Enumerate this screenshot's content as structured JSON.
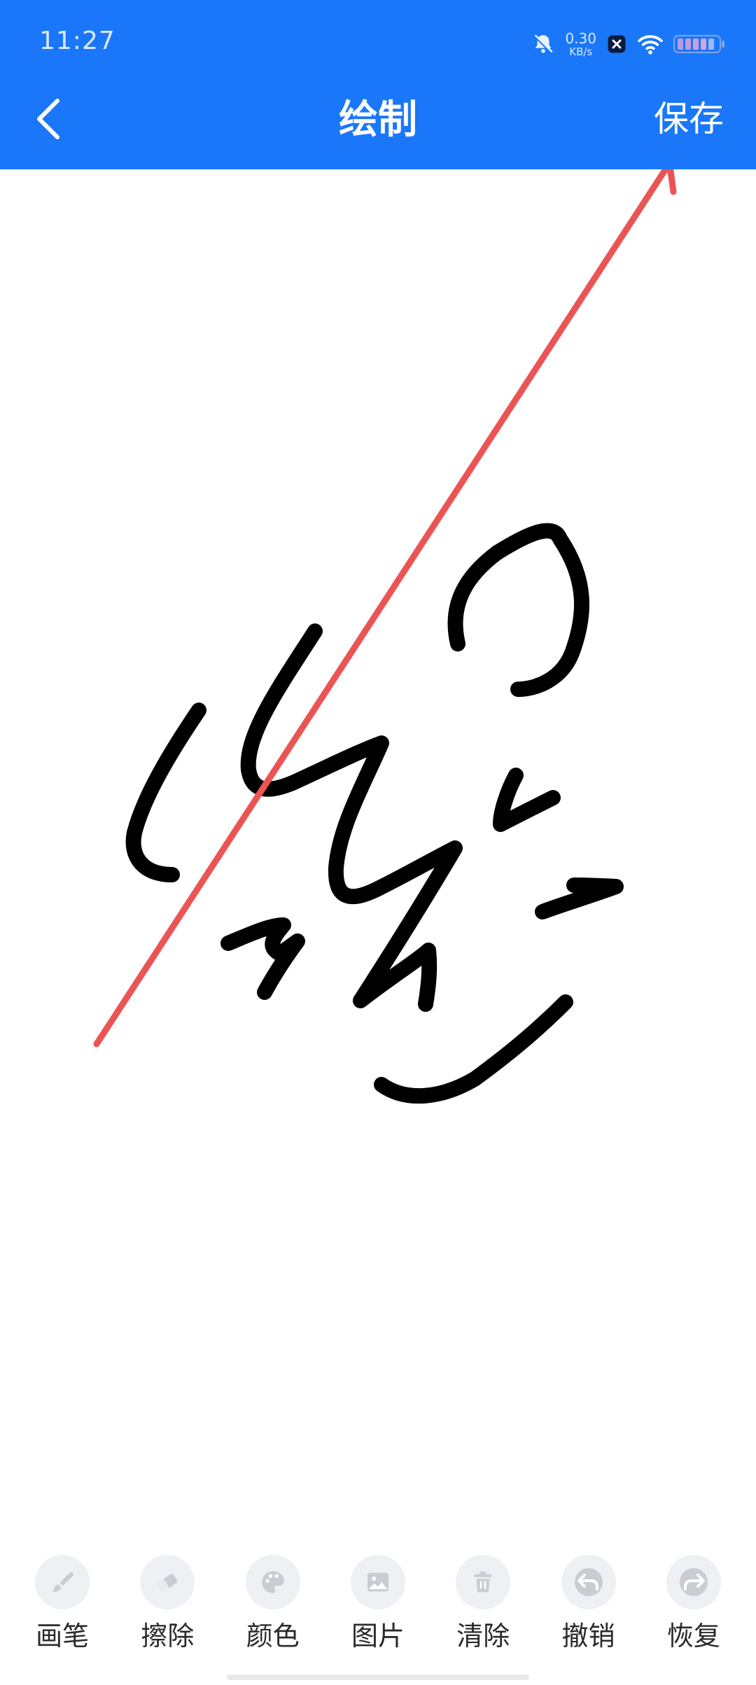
{
  "status_bar": {
    "time": "11:27",
    "net_speed_value": "0.30",
    "net_speed_unit": "KB/s",
    "icons": [
      "bell-muted-icon",
      "app-x-icon",
      "wifi-icon",
      "battery-icon"
    ]
  },
  "app_bar": {
    "back_icon": "chevron-left-icon",
    "title": "绘制",
    "save_label": "保存"
  },
  "canvas": {
    "ink_color": "#000000",
    "annotation_arrow_color": "#ec5454"
  },
  "toolbar": {
    "items": [
      {
        "label": "画笔",
        "icon": "brush-icon"
      },
      {
        "label": "擦除",
        "icon": "eraser-icon"
      },
      {
        "label": "颜色",
        "icon": "palette-icon"
      },
      {
        "label": "图片",
        "icon": "image-icon"
      },
      {
        "label": "清除",
        "icon": "trash-icon"
      },
      {
        "label": "撤销",
        "icon": "undo-icon"
      },
      {
        "label": "恢复",
        "icon": "redo-icon"
      }
    ]
  },
  "colors": {
    "header_bg": "#1a77fa",
    "tool_icon": "#c9cdd3",
    "tool_circle_bg": "#eef0f3"
  }
}
